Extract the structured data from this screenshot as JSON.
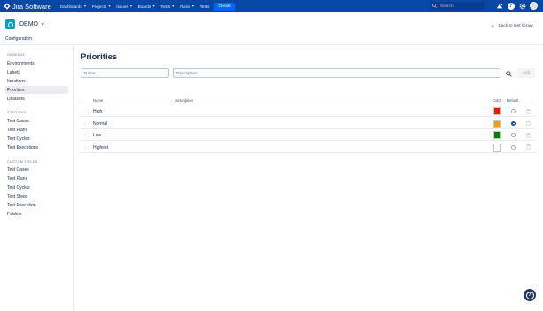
{
  "topnav": {
    "app_name": "Jira Software",
    "items": [
      {
        "label": "Dashboards",
        "dropdown": true
      },
      {
        "label": "Projects",
        "dropdown": true
      },
      {
        "label": "Issues",
        "dropdown": true
      },
      {
        "label": "Boards",
        "dropdown": true
      },
      {
        "label": "Tests",
        "dropdown": true
      },
      {
        "label": "Plans",
        "dropdown": true
      },
      {
        "label": "Tests",
        "dropdown": false
      }
    ],
    "create_label": "Create",
    "search_placeholder": "Search",
    "icons": [
      "notifications-icon",
      "help-icon",
      "settings-icon",
      "avatar"
    ],
    "colors": {
      "bar": "#0747a6",
      "create": "#0065ff"
    }
  },
  "project": {
    "name": "DEMO",
    "subtitle": "Configuration",
    "back_link": "Back to test library"
  },
  "sidebar": {
    "sections": [
      {
        "title": "GENERAL",
        "items": [
          "Environments",
          "Labels",
          "Iterations",
          "Priorities",
          "Datasets"
        ]
      },
      {
        "title": "STATUSES",
        "items": [
          "Test Cases",
          "Test Plans",
          "Test Cycles",
          "Test Executions"
        ]
      },
      {
        "title": "CUSTOM FIELDS",
        "items": [
          "Test Cases",
          "Test Plans",
          "Test Cycles",
          "Test Steps",
          "Test Execution",
          "Folders"
        ]
      }
    ],
    "active": "Priorities"
  },
  "main": {
    "title": "Priorities",
    "name_placeholder": "Name",
    "description_placeholder": "Description",
    "add_label": "Add",
    "columns": {
      "name": "Name",
      "description": "Description",
      "color": "Color",
      "default": "Default"
    },
    "rows": [
      {
        "name": "High",
        "description": "",
        "color": "#e01e00",
        "default": false
      },
      {
        "name": "Normal",
        "description": "",
        "color": "#f79a00",
        "default": true
      },
      {
        "name": "Low",
        "description": "",
        "color": "#0a7a00",
        "default": false
      },
      {
        "name": "Highest",
        "description": "",
        "color": "#ffffff",
        "default": false
      }
    ]
  }
}
